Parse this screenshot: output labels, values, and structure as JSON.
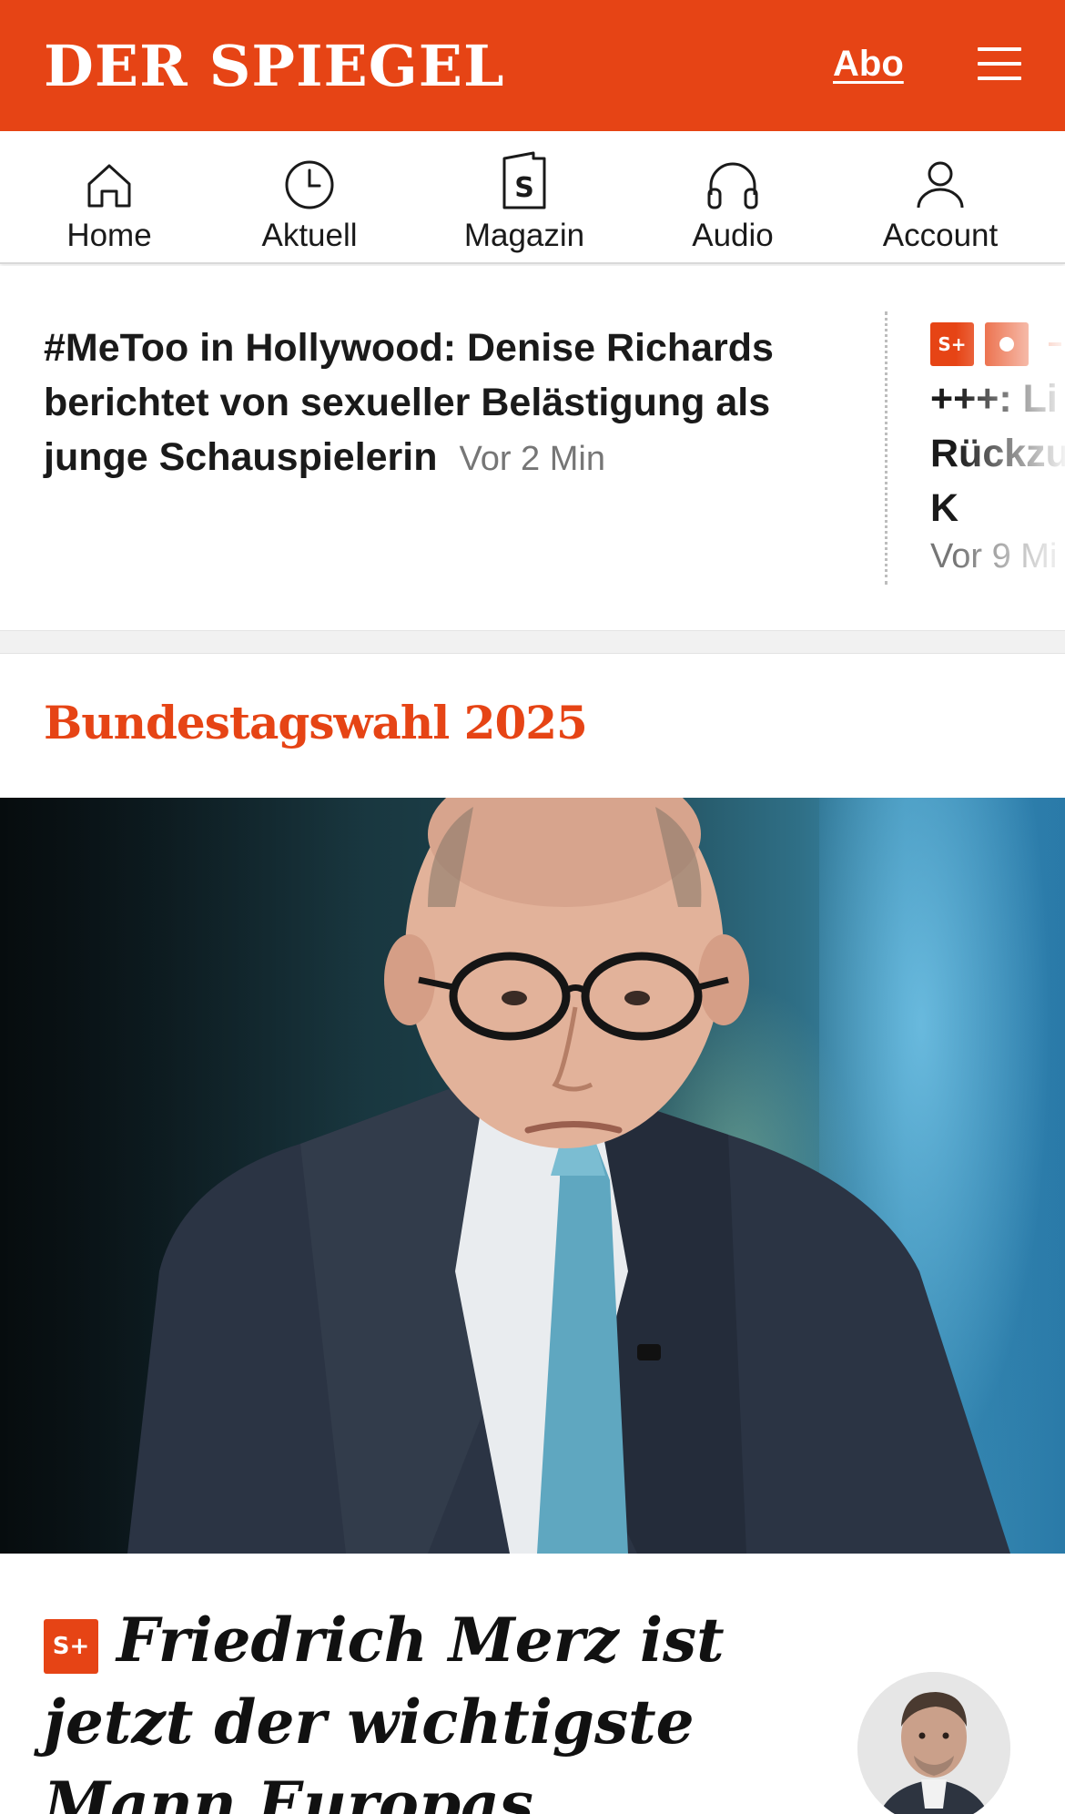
{
  "header": {
    "logo_text": "DER SPIEGEL",
    "abo_label": "Abo",
    "brand_color": "#e64415"
  },
  "nav": {
    "items": [
      {
        "label": "Home",
        "icon": "home-icon"
      },
      {
        "label": "Aktuell",
        "icon": "clock-icon"
      },
      {
        "label": "Magazin",
        "icon": "magazine-icon"
      },
      {
        "label": "Audio",
        "icon": "headphones-icon"
      },
      {
        "label": "Account",
        "icon": "user-icon"
      }
    ]
  },
  "ticker": {
    "main_title": "#MeToo in Hollywood: Denise Richards berichtet von sexueller Belästigung als junge Schauspielerin",
    "main_time": "Vor 2 Min",
    "side_badge_splus": "S+",
    "side_title": "+++: Li Rückzu keine K",
    "side_time": "Vor 9 Mi"
  },
  "section": {
    "title": "Bundestagswahl 2025"
  },
  "article": {
    "badge": "S+",
    "title": "Friedrich Merz ist jetzt der wichtigste Mann Europas"
  }
}
